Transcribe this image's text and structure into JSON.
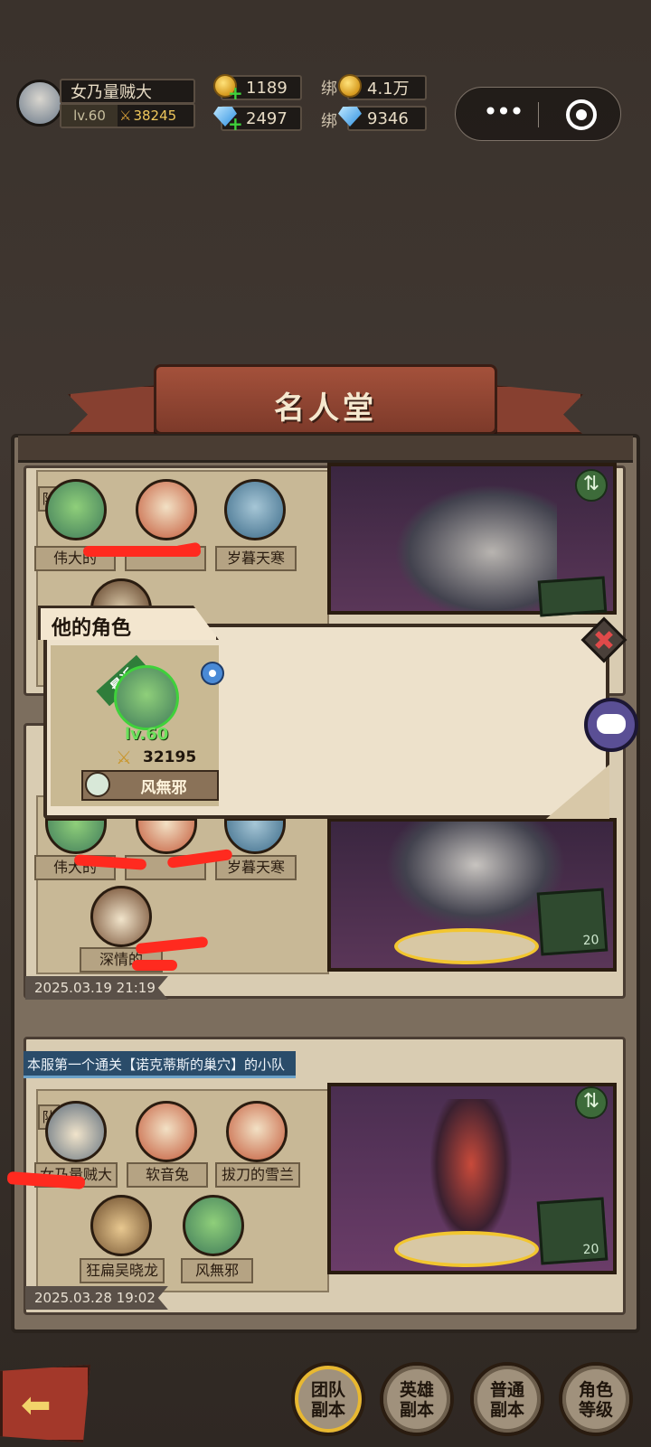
{
  "player": {
    "name": "女乃量贼大",
    "level": "lv.60",
    "power": "38245"
  },
  "currency": {
    "gold": "1189",
    "gems": "2497",
    "bound_prefix": "绑",
    "bound_gold": "4.1万",
    "bound_gems": "9346"
  },
  "banner_title": "名人堂",
  "popup": {
    "tab": "他的角色",
    "badge": "最近",
    "level": "lv.60",
    "power": "32195",
    "name": "风無邪"
  },
  "card1": {
    "squad_tag": "队",
    "members": [
      "伟大的",
      "",
      "岁暮天寒"
    ]
  },
  "card2": {
    "members": [
      "伟大的",
      "",
      "岁暮天寒",
      "深情的"
    ],
    "date": "2025.03.19 21:19",
    "badge_num": "20"
  },
  "card3": {
    "title": "本服第一个通关【诺克蒂斯的巢穴】的小队",
    "squad_tag": "队",
    "members": [
      "女乃量贼大",
      "软音兔",
      "拔刀的雪兰",
      "狂扁吴晓龙",
      "风無邪"
    ],
    "date": "2025.03.28 19:02",
    "badge_num": "20"
  },
  "menu": [
    "团队\n副本",
    "英雄\n副本",
    "普通\n副本",
    "角色\n等级"
  ],
  "colors": {
    "banner": "#a4513b",
    "frame": "#7c6e5e",
    "card": "#d9ccb2",
    "capsule": "#1e1a16",
    "accent_green": "#3fd13b"
  }
}
